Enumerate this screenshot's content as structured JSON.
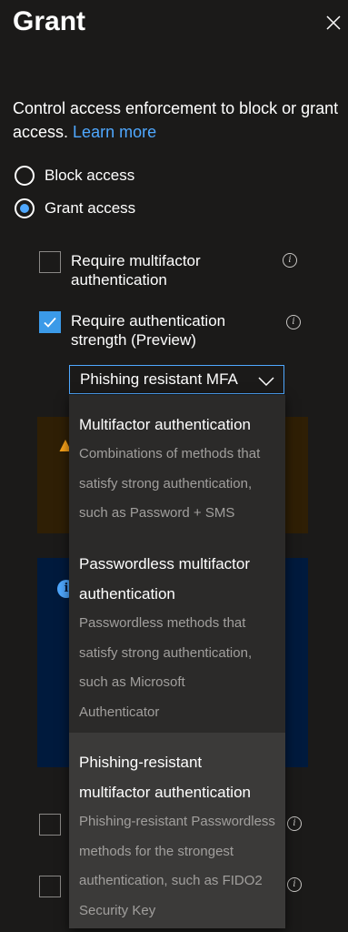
{
  "panel": {
    "title": "Grant",
    "close_icon": "close-icon"
  },
  "description": {
    "text": "Control access enforcement to block or grant access.",
    "link": "Learn more"
  },
  "access_options": [
    {
      "label": "Block access",
      "checked": false
    },
    {
      "label": "Grant access",
      "checked": true
    }
  ],
  "controls": [
    {
      "label": "Require multifactor authentication",
      "checked": false
    },
    {
      "label": "Require authentication strength (Preview)",
      "checked": true
    }
  ],
  "strength_dropdown": {
    "selected": "Phishing resistant MFA",
    "options": [
      {
        "title": "Multifactor authentication",
        "description_lines": [
          "Combinations of methods that",
          "satisfy strong authentication,",
          "such as Password + SMS"
        ]
      },
      {
        "title_lines": [
          "Passwordless multifactor",
          "authentication"
        ],
        "description_lines": [
          "Passwordless methods that",
          "satisfy strong authentication,",
          "such as Microsoft",
          "Authenticator"
        ]
      },
      {
        "title_lines": [
          "Phishing-resistant",
          "multifactor authentication"
        ],
        "description_lines": [
          "Phishing-resistant Passwordless",
          "methods for the strongest",
          "authentication, such as FIDO2",
          "Security Key"
        ]
      }
    ]
  },
  "colors": {
    "background": "#1b1a19",
    "accent": "#4fa8ff",
    "warning_bg": "#2f1f05",
    "info_bg": "#001a3d",
    "warning_icon": "#fca419"
  }
}
